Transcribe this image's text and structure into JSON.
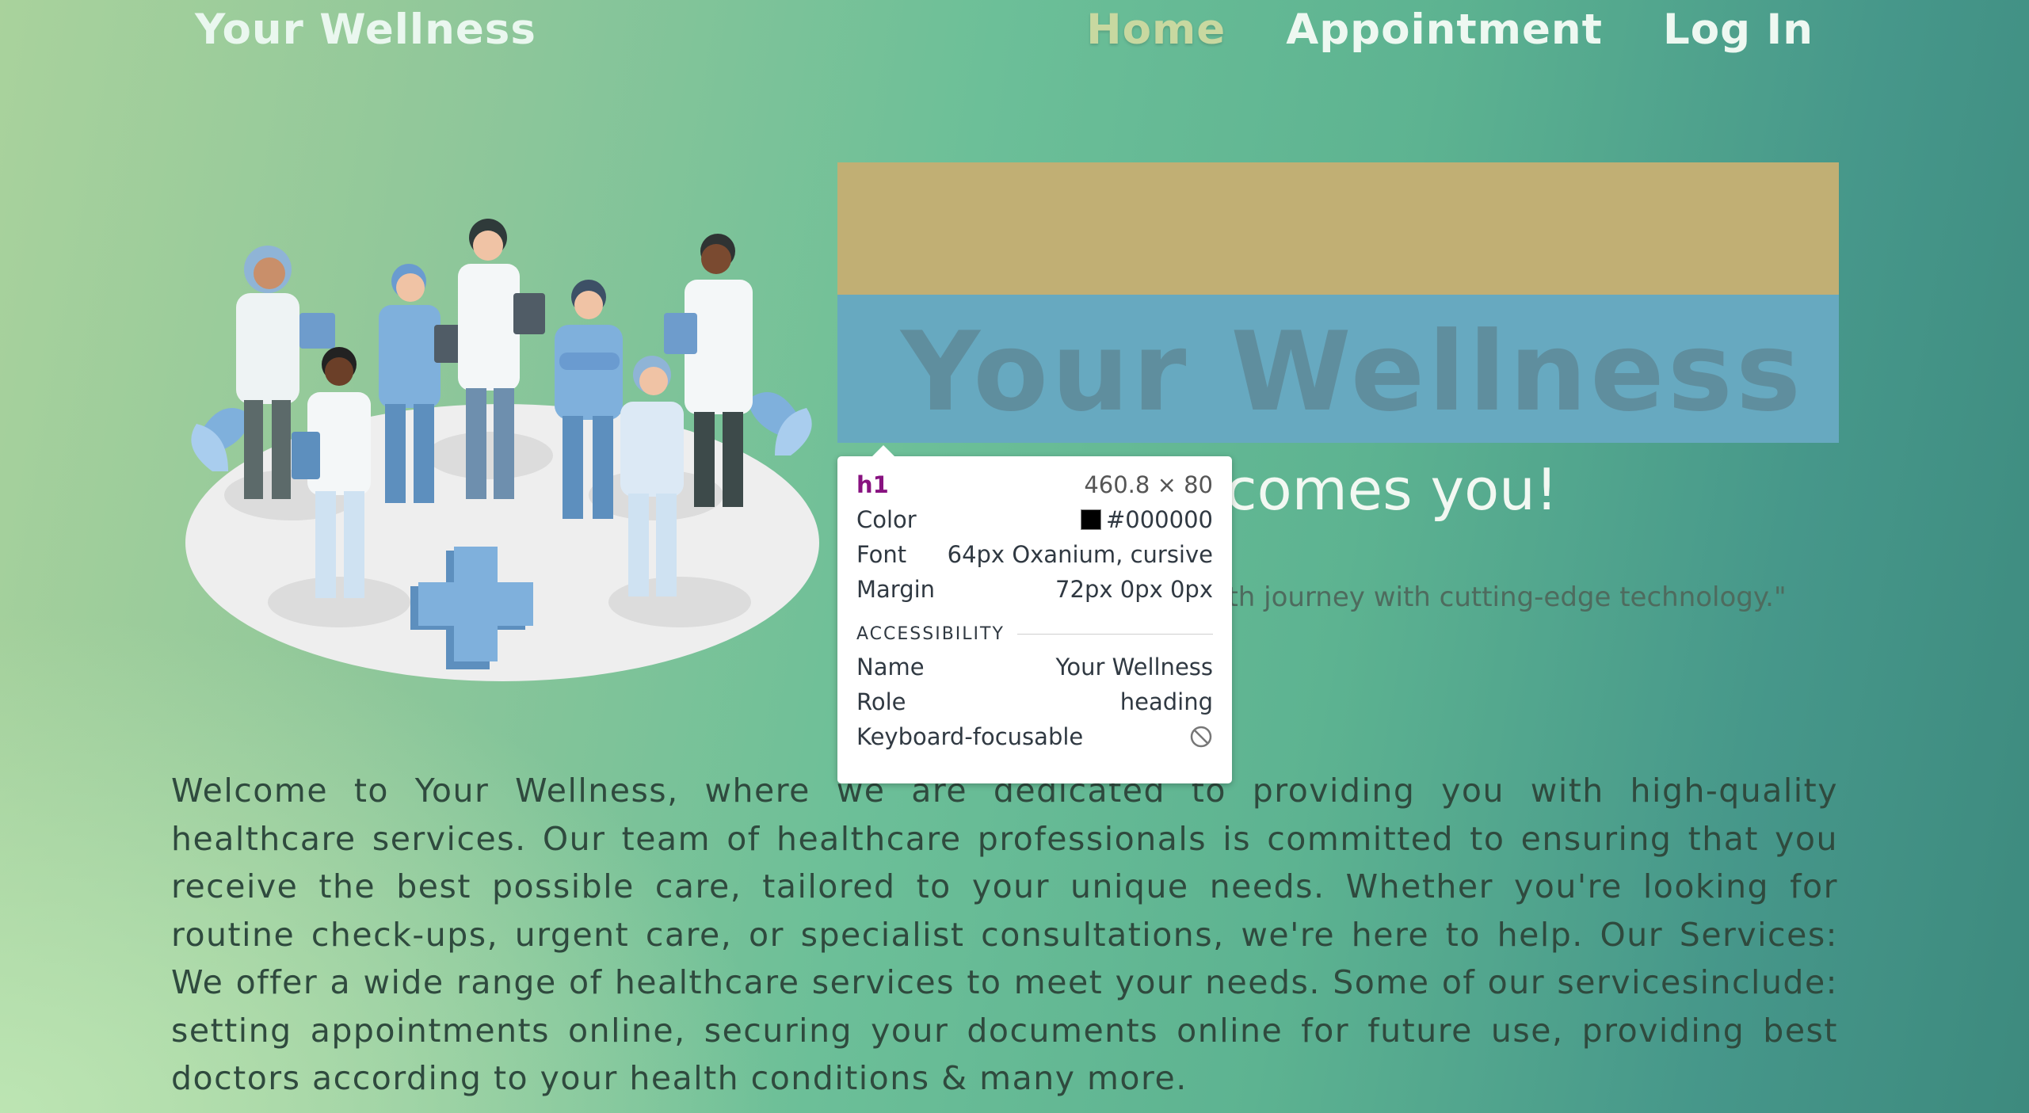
{
  "nav": {
    "brand": "Your Wellness",
    "links": [
      "Home",
      "Appointment",
      "Log In"
    ],
    "active_index": 0
  },
  "hero": {
    "heading": "Your Wellness",
    "subheading": "comes you!",
    "quote": "lth journey with cutting-edge technology.\""
  },
  "tooltip": {
    "tag": "h1",
    "dimensions": "460.8 × 80",
    "color_label": "Color",
    "color_value": "#000000",
    "font_label": "Font",
    "font_value": "64px Oxanium, cursive",
    "margin_label": "Margin",
    "margin_value": "72px 0px 0px",
    "section_title": "ACCESSIBILITY",
    "name_label": "Name",
    "name_value": "Your Wellness",
    "role_label": "Role",
    "role_value": "heading",
    "focusable_label": "Keyboard-focusable",
    "focusable_icon": "no-entry-icon"
  },
  "body_text": "Welcome to Your Wellness, where we are dedicated to providing you with high-quality healthcare services. Our team of healthcare professionals is committed to ensuring that you receive the best possible care, tailored to your unique needs. Whether you're looking for routine check-ups, urgent care, or specialist consultations, we're here to help. Our Services: We offer a wide range of healthcare services to meet your needs. Some of our servicesinclude: setting appointments online, securing your documents online for future use, providing best doctors according to your health conditions & many more.",
  "colors": {
    "margin_overlay": "#c1af74",
    "content_overlay": "#67a9c0",
    "active_nav": "#c8d8a0",
    "tag_purple": "#881280"
  },
  "illustration": {
    "icon": "medical-team-illustration"
  }
}
